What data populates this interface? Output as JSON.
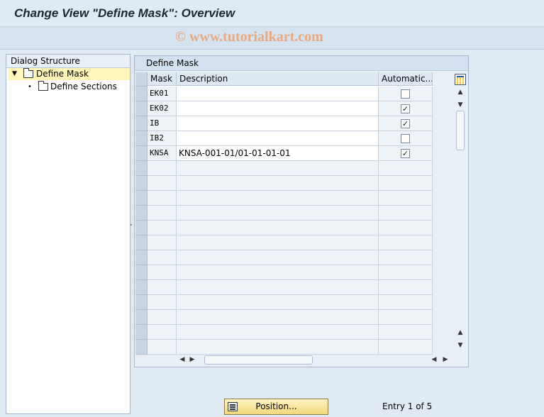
{
  "window": {
    "title": "Change View \"Define Mask\": Overview"
  },
  "watermark": "© www.tutorialkart.com",
  "dialog_structure": {
    "header": "Dialog Structure",
    "items": [
      {
        "label": "Define Mask",
        "level": 0,
        "expanded": true,
        "selected": true,
        "icon": "folder-open-icon"
      },
      {
        "label": "Define Sections",
        "level": 1,
        "expanded": false,
        "selected": false,
        "icon": "folder-icon"
      }
    ]
  },
  "table": {
    "title": "Define Mask",
    "columns": [
      "Mask",
      "Description",
      "Automatic..."
    ],
    "rows": [
      {
        "mask": "EK01",
        "description": "",
        "automatic": false
      },
      {
        "mask": "EK02",
        "description": "",
        "automatic": true
      },
      {
        "mask": "IB",
        "description": "",
        "automatic": true
      },
      {
        "mask": "IB2",
        "description": "",
        "automatic": false
      },
      {
        "mask": "KNSA",
        "description": "KNSA-001-01/01-01-01-01",
        "automatic": true
      }
    ],
    "empty_rows": 13
  },
  "footer": {
    "position_label": "Position...",
    "entry_info": "Entry 1 of 5"
  }
}
